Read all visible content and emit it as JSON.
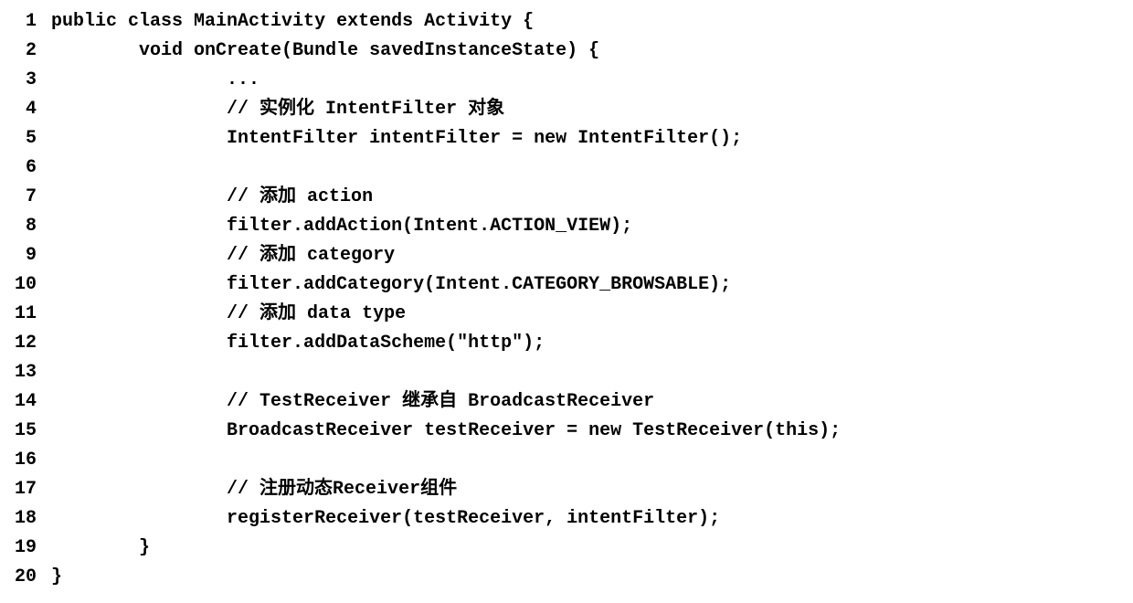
{
  "code": {
    "lines": [
      {
        "num": "1",
        "text": "public class MainActivity extends Activity {"
      },
      {
        "num": "2",
        "text": "        void onCreate(Bundle savedInstanceState) {"
      },
      {
        "num": "3",
        "text": "                ..."
      },
      {
        "num": "4",
        "text": "                // 实例化 IntentFilter 对象"
      },
      {
        "num": "5",
        "text": "                IntentFilter intentFilter = new IntentFilter();"
      },
      {
        "num": "6",
        "text": ""
      },
      {
        "num": "7",
        "text": "                // 添加 action"
      },
      {
        "num": "8",
        "text": "                filter.addAction(Intent.ACTION_VIEW);"
      },
      {
        "num": "9",
        "text": "                // 添加 category"
      },
      {
        "num": "10",
        "text": "                filter.addCategory(Intent.CATEGORY_BROWSABLE);"
      },
      {
        "num": "11",
        "text": "                // 添加 data type"
      },
      {
        "num": "12",
        "text": "                filter.addDataScheme(\"http\");"
      },
      {
        "num": "13",
        "text": ""
      },
      {
        "num": "14",
        "text": "                // TestReceiver 继承自 BroadcastReceiver"
      },
      {
        "num": "15",
        "text": "                BroadcastReceiver testReceiver = new TestReceiver(this);"
      },
      {
        "num": "16",
        "text": ""
      },
      {
        "num": "17",
        "text": "                // 注册动态Receiver组件"
      },
      {
        "num": "18",
        "text": "                registerReceiver(testReceiver, intentFilter);"
      },
      {
        "num": "19",
        "text": "        }"
      },
      {
        "num": "20",
        "text": "}"
      }
    ]
  }
}
